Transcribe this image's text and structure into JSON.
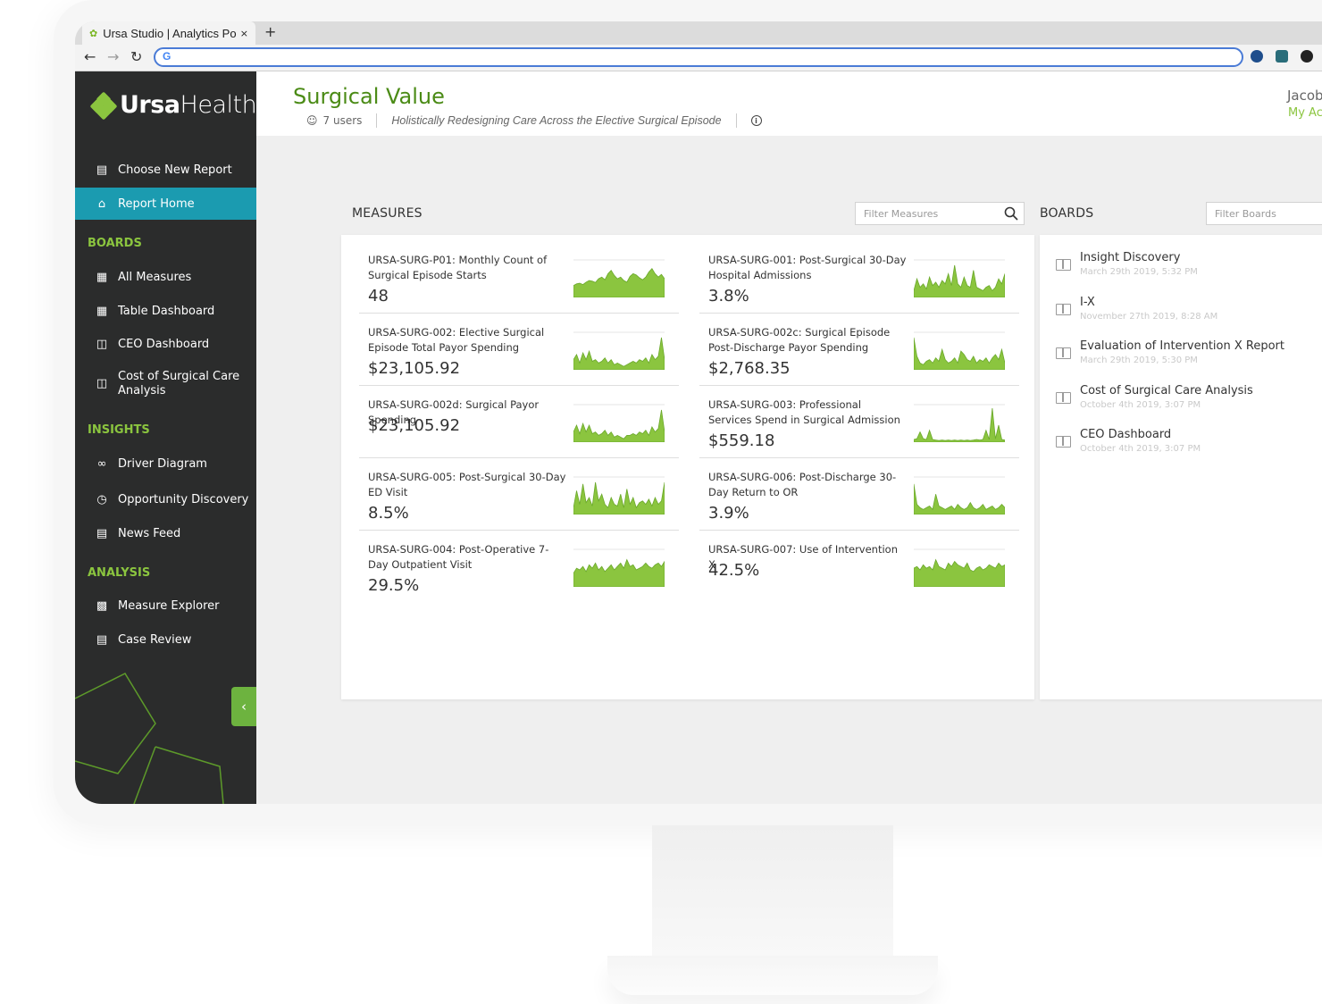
{
  "browser": {
    "tab_title": "Ursa Studio | Analytics Po",
    "tab_close": "×",
    "new_tab": "+",
    "omnibox_text": "G"
  },
  "brand": {
    "logo_bold": "Ursa",
    "logo_light": "Health",
    "accent": "#8bc53f",
    "active_bg": "#1b9bb0",
    "title_color": "#4b8b16"
  },
  "sidebar": {
    "top_items": [
      {
        "label": "Choose New Report",
        "icon": "report-icon"
      },
      {
        "label": "Report Home",
        "icon": "home-icon"
      }
    ],
    "sections": [
      {
        "title": "BOARDS",
        "items": [
          {
            "label": "All Measures",
            "icon": "measures-icon"
          },
          {
            "label": "Table Dashboard",
            "icon": "table-icon"
          },
          {
            "label": "CEO Dashboard",
            "icon": "board-icon"
          },
          {
            "label": "Cost of Surgical Care Analysis",
            "icon": "board-icon"
          }
        ]
      },
      {
        "title": "INSIGHTS",
        "items": [
          {
            "label": "Driver Diagram",
            "icon": "driver-icon"
          },
          {
            "label": "Opportunity Discovery",
            "icon": "discovery-icon"
          },
          {
            "label": "News Feed",
            "icon": "news-icon"
          }
        ]
      },
      {
        "title": "ANALYSIS",
        "items": [
          {
            "label": "Measure Explorer",
            "icon": "chart-icon"
          },
          {
            "label": "Case Review",
            "icon": "case-icon"
          }
        ]
      }
    ],
    "collapse_glyph": "‹"
  },
  "header": {
    "title": "Surgical Value",
    "users": "7 users",
    "description": "Holistically Redesigning Care Across the Elective Surgical Episode",
    "user_name": "Jacob",
    "account_link": "My Acc"
  },
  "measures": {
    "label": "MEASURES",
    "filter_placeholder": "Filter Measures",
    "items": [
      {
        "title": "URSA-SURG-P01: Monthly Count of Surgical Episode Starts",
        "value": "48",
        "spark": [
          0.35,
          0.4,
          0.42,
          0.38,
          0.45,
          0.5,
          0.48,
          0.44,
          0.55,
          0.6,
          0.52,
          0.7,
          0.8,
          0.65,
          0.55,
          0.6,
          0.5,
          0.45,
          0.62,
          0.7,
          0.66,
          0.58,
          0.52,
          0.6,
          0.75,
          0.85,
          0.7,
          0.6,
          0.68,
          0.55
        ]
      },
      {
        "title": "URSA-SURG-001: Post-Surgical 30-Day Hospital Admissions",
        "value": "3.8%",
        "spark": [
          0.2,
          0.55,
          0.3,
          0.4,
          0.25,
          0.6,
          0.35,
          0.45,
          0.3,
          0.5,
          0.4,
          0.7,
          0.35,
          0.95,
          0.4,
          0.3,
          0.6,
          0.35,
          0.3,
          0.8,
          0.3,
          0.25,
          0.2,
          0.3,
          0.35,
          0.2,
          0.3,
          0.55,
          0.4,
          0.7
        ]
      },
      {
        "title": "URSA-SURG-002: Elective Surgical Episode Total Payor Spending",
        "value": "$23,105.92",
        "spark": [
          0.3,
          0.45,
          0.2,
          0.5,
          0.3,
          0.55,
          0.25,
          0.3,
          0.2,
          0.25,
          0.35,
          0.2,
          0.3,
          0.15,
          0.2,
          0.15,
          0.1,
          0.15,
          0.2,
          0.25,
          0.2,
          0.3,
          0.25,
          0.35,
          0.2,
          0.45,
          0.3,
          0.4,
          0.95,
          0.3
        ]
      },
      {
        "title": "URSA-SURG-002c: Surgical Episode Post-Discharge Payor Spending",
        "value": "$2,768.35",
        "spark": [
          0.95,
          0.4,
          0.2,
          0.15,
          0.25,
          0.3,
          0.2,
          0.35,
          0.25,
          0.6,
          0.3,
          0.2,
          0.25,
          0.35,
          0.2,
          0.55,
          0.45,
          0.3,
          0.25,
          0.4,
          0.2,
          0.3,
          0.25,
          0.35,
          0.2,
          0.35,
          0.45,
          0.3,
          0.6,
          0.2
        ]
      },
      {
        "title": "URSA-SURG-002d: Surgical Payor Spending",
        "value": "$23,105.92",
        "spark": [
          0.3,
          0.5,
          0.25,
          0.55,
          0.3,
          0.5,
          0.25,
          0.3,
          0.2,
          0.25,
          0.35,
          0.2,
          0.3,
          0.15,
          0.2,
          0.15,
          0.1,
          0.2,
          0.2,
          0.25,
          0.2,
          0.3,
          0.25,
          0.35,
          0.2,
          0.45,
          0.3,
          0.4,
          0.95,
          0.3
        ]
      },
      {
        "title": "URSA-SURG-003: Professional Services Spend in Surgical Admission",
        "value": "$559.18",
        "spark": [
          0.08,
          0.1,
          0.3,
          0.1,
          0.08,
          0.35,
          0.08,
          0.06,
          0.05,
          0.06,
          0.05,
          0.06,
          0.05,
          0.06,
          0.05,
          0.06,
          0.05,
          0.06,
          0.05,
          0.06,
          0.08,
          0.06,
          0.08,
          0.35,
          0.08,
          1.0,
          0.1,
          0.5,
          0.08,
          0.06
        ]
      },
      {
        "title": "URSA-SURG-005: Post-Surgical 30-Day ED Visit",
        "value": "8.5%",
        "spark": [
          0.2,
          0.7,
          0.3,
          0.9,
          0.35,
          0.5,
          0.25,
          0.95,
          0.4,
          0.6,
          0.3,
          0.2,
          0.5,
          0.3,
          0.25,
          0.6,
          0.2,
          0.75,
          0.3,
          0.5,
          0.2,
          0.35,
          0.4,
          0.3,
          0.45,
          0.25,
          0.5,
          0.3,
          0.4,
          0.95
        ]
      },
      {
        "title": "URSA-SURG-006: Post-Discharge 30-Day Return to OR",
        "value": "3.9%",
        "spark": [
          0.9,
          0.3,
          0.2,
          0.15,
          0.2,
          0.25,
          0.15,
          0.6,
          0.25,
          0.2,
          0.15,
          0.2,
          0.25,
          0.15,
          0.3,
          0.2,
          0.15,
          0.2,
          0.35,
          0.2,
          0.15,
          0.2,
          0.3,
          0.15,
          0.2,
          0.25,
          0.15,
          0.2,
          0.3,
          0.2
        ]
      },
      {
        "title": "URSA-SURG-004: Post-Operative 7-Day Outpatient Visit",
        "value": "29.5%",
        "spark": [
          0.4,
          0.55,
          0.5,
          0.6,
          0.45,
          0.65,
          0.55,
          0.7,
          0.5,
          0.6,
          0.45,
          0.55,
          0.65,
          0.5,
          0.6,
          0.7,
          0.55,
          0.8,
          0.6,
          0.65,
          0.5,
          0.55,
          0.6,
          0.7,
          0.6,
          0.55,
          0.65,
          0.7,
          0.6,
          0.75
        ]
      },
      {
        "title": "URSA-SURG-007: Use of Intervention X",
        "value": "42.5%",
        "spark": [
          0.55,
          0.6,
          0.5,
          0.65,
          0.55,
          0.6,
          0.5,
          0.8,
          0.6,
          0.55,
          0.5,
          0.7,
          0.6,
          0.75,
          0.65,
          0.6,
          0.55,
          0.7,
          0.5,
          0.45,
          0.55,
          0.6,
          0.5,
          0.55,
          0.65,
          0.6,
          0.55,
          0.7,
          0.6,
          0.65
        ]
      }
    ]
  },
  "boards": {
    "label": "BOARDS",
    "filter_placeholder": "Filter Boards",
    "items": [
      {
        "name": "Insight Discovery",
        "date": "March 29th 2019, 5:32 PM"
      },
      {
        "name": "I-X",
        "date": "November 27th 2019, 8:28 AM"
      },
      {
        "name": "Evaluation of Intervention X Report",
        "date": "March 29th 2019, 5:30 PM"
      },
      {
        "name": "Cost of Surgical Care Analysis",
        "date": "October 4th 2019, 3:07 PM"
      },
      {
        "name": "CEO Dashboard",
        "date": "October 4th 2019, 3:07 PM"
      }
    ]
  }
}
